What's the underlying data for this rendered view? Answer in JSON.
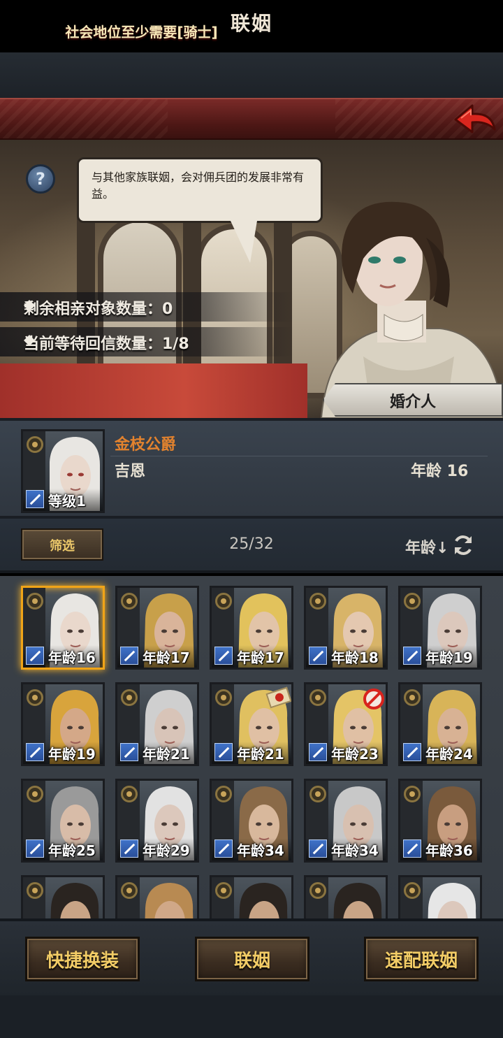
{
  "header": {
    "title": "联姻"
  },
  "intro": {
    "speech": "与其他家族联姻，会对佣兵团的发展非常有益。",
    "remaining_label": "剩余相亲对象数量：0",
    "waiting_label": "当前等待回信数量：1/8",
    "requirement": "社会地位至少需要[骑士]",
    "matchmaker_button": "婚介人"
  },
  "selected": {
    "title": "金枝公爵",
    "name": "吉恩",
    "age_text": "年龄 16",
    "level_label": "等级1"
  },
  "filter": {
    "filter_button": "筛选",
    "count": "25/32",
    "sort_label": "年龄↓"
  },
  "candidates": [
    {
      "age_label": "年龄16",
      "hair": "#e8e6e2",
      "skin": "#e9d8cc",
      "selected": true
    },
    {
      "age_label": "年龄17",
      "hair": "#c8a04a",
      "skin": "#d9b49a"
    },
    {
      "age_label": "年龄17",
      "hair": "#e2c25c",
      "skin": "#e2c4a8"
    },
    {
      "age_label": "年龄18",
      "hair": "#d8b468",
      "skin": "#e4c8b0"
    },
    {
      "age_label": "年龄19",
      "hair": "#cfcfcf",
      "skin": "#dcc8bc"
    },
    {
      "age_label": "年龄19",
      "hair": "#d8a43c",
      "skin": "#d4a888"
    },
    {
      "age_label": "年龄21",
      "hair": "#cfcfcf",
      "skin": "#d8c4b8"
    },
    {
      "age_label": "年龄21",
      "hair": "#e0c060",
      "skin": "#e0c0a4",
      "badge": "seal"
    },
    {
      "age_label": "年龄23",
      "hair": "#e4c466",
      "skin": "#e0c0a4",
      "badge": "ban"
    },
    {
      "age_label": "年龄24",
      "hair": "#d8b458",
      "skin": "#d8b294"
    },
    {
      "age_label": "年龄25",
      "hair": "#9a9a9a",
      "skin": "#d8bca8"
    },
    {
      "age_label": "年龄29",
      "hair": "#e2e2e2",
      "skin": "#dcc8bc"
    },
    {
      "age_label": "年龄34",
      "hair": "#8a6a48",
      "skin": "#d8b89c"
    },
    {
      "age_label": "年龄34",
      "hair": "#c8c8c8",
      "skin": "#d8c0b0"
    },
    {
      "age_label": "年龄36",
      "hair": "#7a5a3c",
      "skin": "#c89e80"
    },
    {
      "age_label": "",
      "hair": "#2a2420",
      "skin": "#c8a486"
    },
    {
      "age_label": "",
      "hair": "#b88a52",
      "skin": "#d0a888"
    },
    {
      "age_label": "",
      "hair": "#2a2420",
      "skin": "#c8a486"
    },
    {
      "age_label": "",
      "hair": "#2a2420",
      "skin": "#c8a486"
    },
    {
      "age_label": "",
      "hair": "#e6e6e6",
      "skin": "#dcc8bc"
    }
  ],
  "actions": {
    "quick_equip": "快捷换装",
    "marry": "联姻",
    "quick_match": "速配联姻"
  },
  "colors": {
    "title_red": "#7a2a28",
    "accent_orange": "#e2822e",
    "button_gold": "#f2cc66",
    "selected_border": "#f0a418"
  },
  "icons": [
    "help-icon",
    "back-arrow-icon",
    "refresh-icon",
    "crest-icon",
    "sword-class-icon",
    "ban-icon",
    "seal-icon"
  ]
}
